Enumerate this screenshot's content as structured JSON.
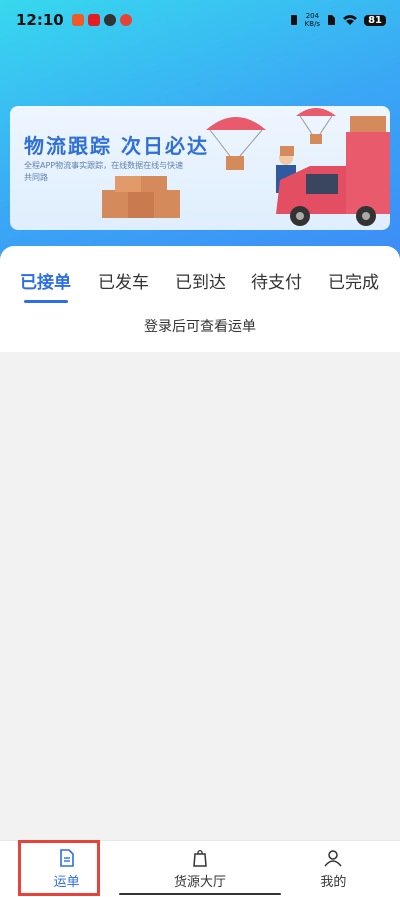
{
  "status_bar": {
    "time": "12:10",
    "net_speed_value": "204",
    "net_speed_unit": "KB/s",
    "battery": "81"
  },
  "banner": {
    "title": "物流跟踪 次日必达",
    "subtitle": "全程APP物流事实跟踪，在线数据在线与快速共同路"
  },
  "tabs": [
    {
      "label": "已接单",
      "active": true
    },
    {
      "label": "已发车",
      "active": false
    },
    {
      "label": "已到达",
      "active": false
    },
    {
      "label": "待支付",
      "active": false
    },
    {
      "label": "已完成",
      "active": false
    }
  ],
  "login_hint": "登录后可查看运单",
  "bottom_nav": [
    {
      "label": "运单",
      "icon": "document-icon",
      "active": true
    },
    {
      "label": "货源大厅",
      "icon": "bag-icon",
      "active": false
    },
    {
      "label": "我的",
      "icon": "user-icon",
      "active": false
    }
  ],
  "colors": {
    "accent": "#2b6ee6",
    "highlight": "#e8433a",
    "header_start": "#38d8ee",
    "header_end": "#3d8cf6"
  }
}
